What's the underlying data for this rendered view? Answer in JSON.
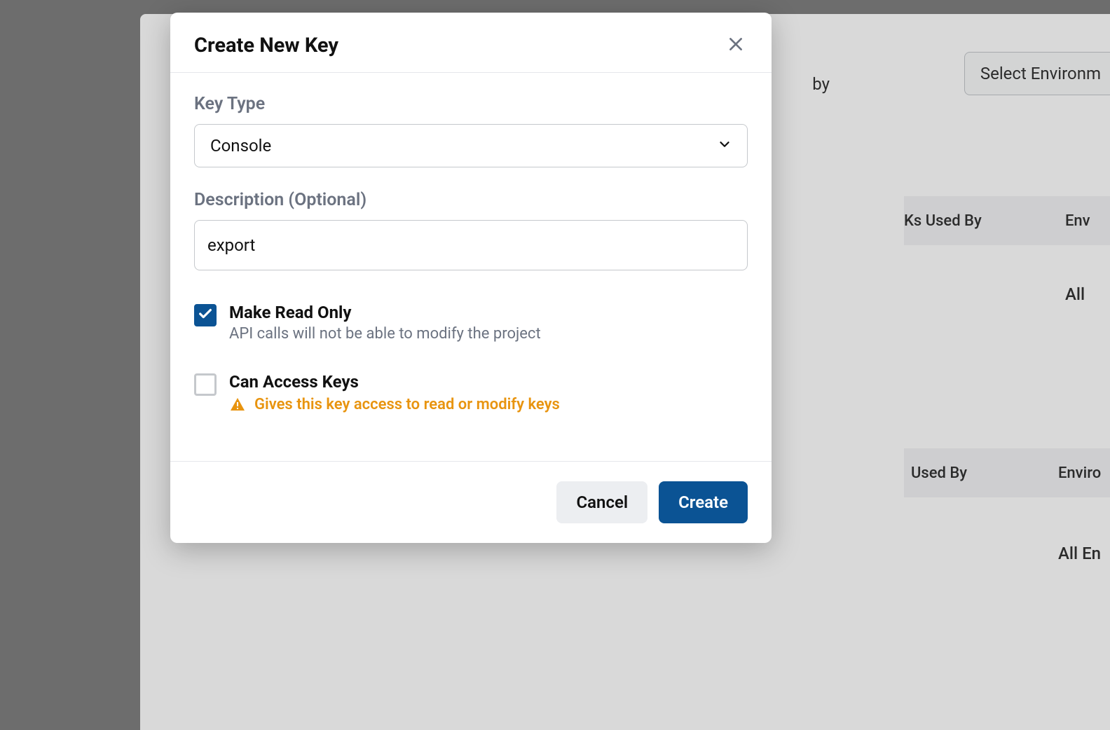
{
  "background": {
    "filter_by_label": "by",
    "select_environment_label": "Select Environm",
    "table1": {
      "col_keys_used_by": "Ks Used By",
      "col_env": "Env",
      "row_all": "All"
    },
    "table2": {
      "col_used_by": "Used By",
      "col_env": "Enviro",
      "row_all": "All En"
    }
  },
  "modal": {
    "title": "Create New Key",
    "key_type": {
      "label": "Key Type",
      "value": "Console"
    },
    "description": {
      "label": "Description (Optional)",
      "value": "export"
    },
    "readonly": {
      "label": "Make Read Only",
      "hint": "API calls will not be able to modify the project",
      "checked": true
    },
    "access_keys": {
      "label": "Can Access Keys",
      "warning": "Gives this key access to read or modify keys",
      "checked": false
    },
    "buttons": {
      "cancel": "Cancel",
      "create": "Create"
    }
  }
}
